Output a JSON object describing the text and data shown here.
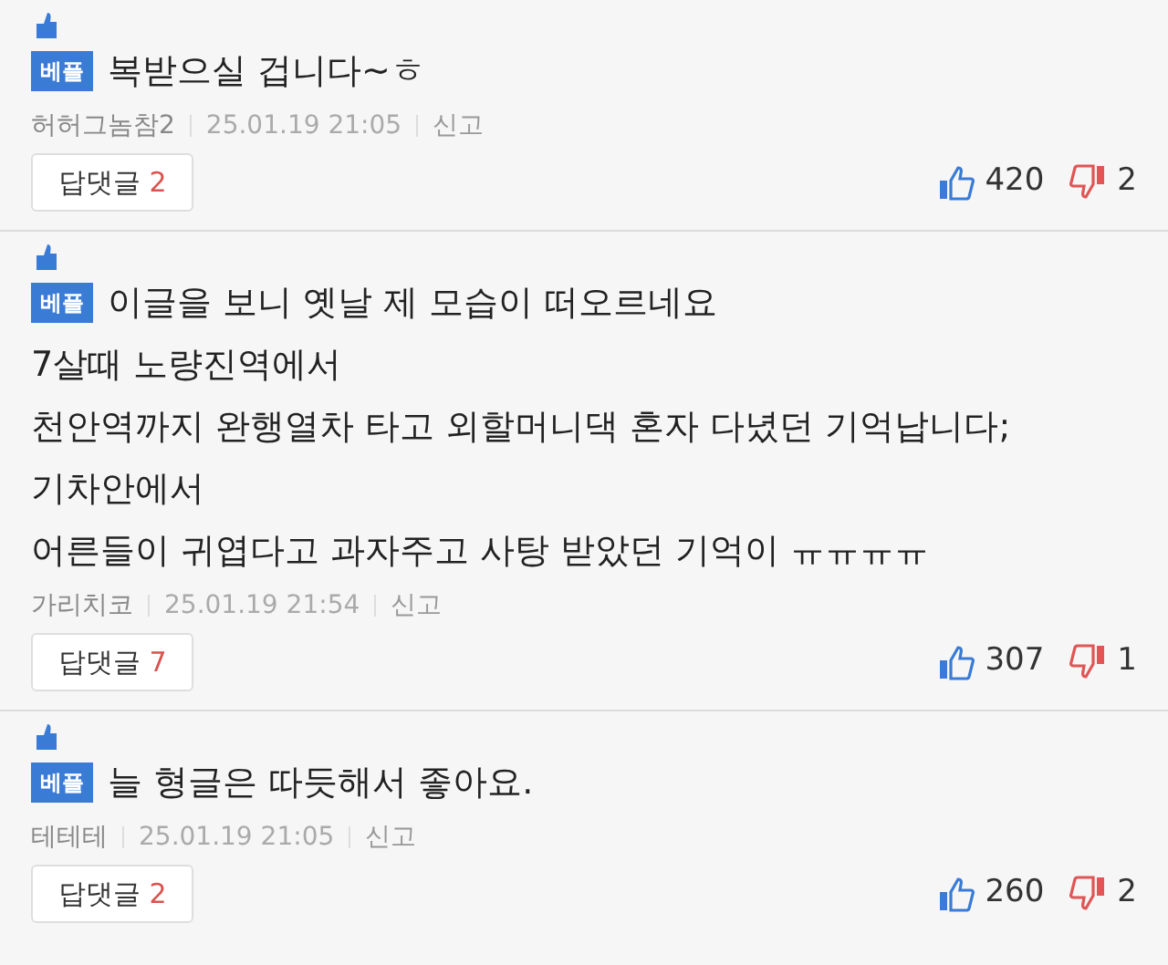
{
  "comments": [
    {
      "badge": "베플",
      "body": "복받으실 겁니다~ㅎ",
      "author": "허허그놈참2",
      "date": "25.01.19  21:05",
      "report": "신고",
      "reply_label": "답댓글",
      "reply_count": "2",
      "likes": "420",
      "dislikes": "2"
    },
    {
      "badge": "베플",
      "body": "이글을 보니 옛날 제 모습이 떠오르네요\n7살때 노량진역에서\n천안역까지 완행열차 타고 외할머니댁 혼자 다녔던 기억납니다;\n기차안에서\n어른들이 귀엽다고 과자주고 사탕 받았던 기억이 ㅠㅠㅠㅠ",
      "author": "가리치코",
      "date": "25.01.19  21:54",
      "report": "신고",
      "reply_label": "답댓글",
      "reply_count": "7",
      "likes": "307",
      "dislikes": "1"
    },
    {
      "badge": "베플",
      "body": "늘 형글은 따듯해서 좋아요.",
      "author": "테테테",
      "date": "25.01.19  21:05",
      "report": "신고",
      "reply_label": "답댓글",
      "reply_count": "2",
      "likes": "260",
      "dislikes": "2"
    }
  ]
}
